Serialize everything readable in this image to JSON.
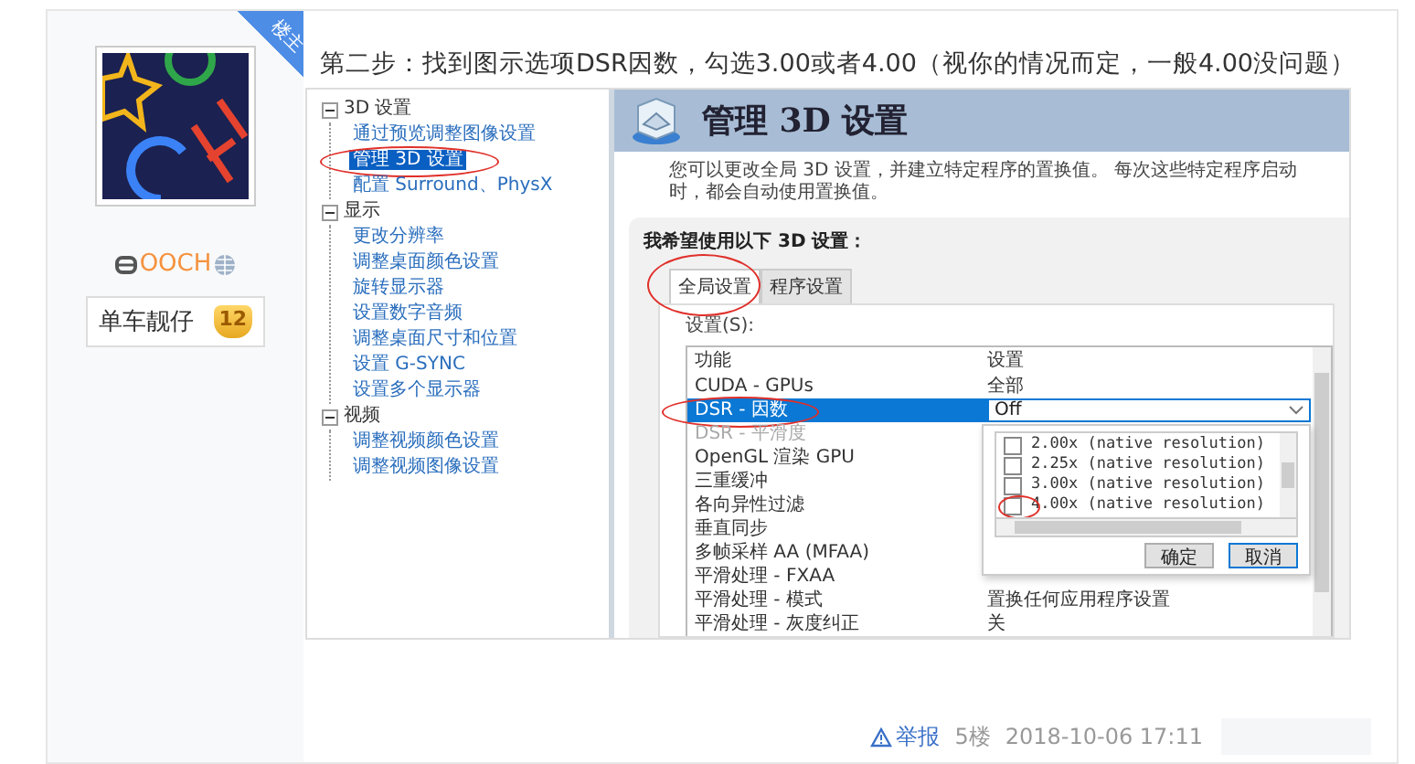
{
  "post_badge": "楼主",
  "user": {
    "name": "OOCH",
    "title": "单车靓仔",
    "level": "12"
  },
  "post": {
    "text": "第二步：找到图示选项DSR因数，勾选3.00或者4.00（视你的情况而定，一般4.00没问题）"
  },
  "screenshot": {
    "tree": [
      {
        "label": "3D 设置",
        "expanded": true,
        "children": [
          {
            "label": "通过预览调整图像设置",
            "selected": false,
            "circled": false
          },
          {
            "label": "管理 3D 设置",
            "selected": true,
            "circled": true
          },
          {
            "label": "配置 Surround、PhysX",
            "selected": false,
            "circled": false
          }
        ]
      },
      {
        "label": "显示",
        "expanded": true,
        "children": [
          {
            "label": "更改分辨率",
            "selected": false,
            "circled": false
          },
          {
            "label": "调整桌面颜色设置",
            "selected": false,
            "circled": false
          },
          {
            "label": "旋转显示器",
            "selected": false,
            "circled": false
          },
          {
            "label": "设置数字音频",
            "selected": false,
            "circled": false
          },
          {
            "label": "调整桌面尺寸和位置",
            "selected": false,
            "circled": false
          },
          {
            "label": "设置 G-SYNC",
            "selected": false,
            "circled": false
          },
          {
            "label": "设置多个显示器",
            "selected": false,
            "circled": false
          }
        ]
      },
      {
        "label": "视频",
        "expanded": true,
        "children": [
          {
            "label": "调整视频颜色设置",
            "selected": false,
            "circled": false
          },
          {
            "label": "调整视频图像设置",
            "selected": false,
            "circled": false
          }
        ]
      }
    ],
    "panel": {
      "title": "管理 3D 设置",
      "description": "您可以更改全局 3D 设置，并建立特定程序的置换值。 每次这些特定程序启动时，都会自动使用置换值。",
      "heading": "我希望使用以下 3D 设置：",
      "tabs": [
        {
          "label": "全局设置",
          "selected": true,
          "circled": true
        },
        {
          "label": "程序设置",
          "selected": false,
          "circled": false
        }
      ],
      "settings_label": "设置(S):",
      "columns": [
        "功能",
        "设置"
      ],
      "rows": [
        {
          "feature": "CUDA - GPUs",
          "value": "全部",
          "selected": false,
          "disabled": false,
          "circled": false
        },
        {
          "feature": "DSR - 因数",
          "value": "Off",
          "selected": true,
          "disabled": false,
          "circled": true
        },
        {
          "feature": "DSR - 平滑度",
          "selected": false,
          "disabled": true,
          "circled": false
        },
        {
          "feature": "OpenGL 渲染 GPU",
          "selected": false,
          "disabled": false,
          "circled": false
        },
        {
          "feature": "三重缓冲",
          "selected": false,
          "disabled": false,
          "circled": false
        },
        {
          "feature": "各向异性过滤",
          "selected": false,
          "disabled": false,
          "circled": false
        },
        {
          "feature": "垂直同步",
          "selected": false,
          "disabled": false,
          "circled": false
        },
        {
          "feature": "多帧采样 AA (MFAA)",
          "selected": false,
          "disabled": false,
          "circled": false
        },
        {
          "feature": "平滑处理 - FXAA",
          "selected": false,
          "disabled": false,
          "circled": false
        },
        {
          "feature": "平滑处理 - 模式",
          "value": "置换任何应用程序设置",
          "selected": false,
          "disabled": false,
          "circled": false
        },
        {
          "feature": "平滑处理 - 灰度纠正",
          "value": "关",
          "selected": false,
          "disabled": false,
          "circled": false
        }
      ],
      "dropdown": {
        "options": [
          {
            "label": "2.00x (native resolution)",
            "checked": false,
            "circled": false
          },
          {
            "label": "2.25x (native resolution)",
            "checked": false,
            "circled": false
          },
          {
            "label": "3.00x (native resolution)",
            "checked": false,
            "circled": false
          },
          {
            "label": "4.00x (native resolution)",
            "checked": false,
            "circled": true
          }
        ],
        "buttons": [
          "确定",
          "取消"
        ]
      }
    }
  },
  "footer": {
    "report": "举报",
    "floor": "5楼",
    "time": "2018-10-06 17:11"
  }
}
